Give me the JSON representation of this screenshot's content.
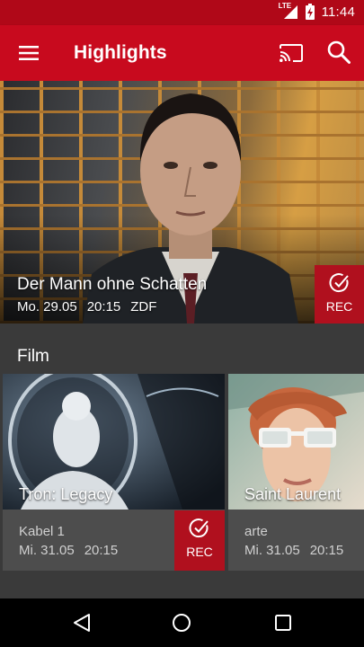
{
  "status_bar": {
    "network": "LTE",
    "time": "11:44"
  },
  "app_bar": {
    "title": "Highlights",
    "icons": [
      "menu-icon",
      "cast-icon",
      "search-icon"
    ]
  },
  "hero": {
    "title": "Der Mann ohne Schatten",
    "date": "Mo. 29.05",
    "time": "20:15",
    "channel": "ZDF",
    "rec_label": "REC",
    "rec_icon": "check-circle-icon"
  },
  "section": {
    "title": "Film"
  },
  "cards": [
    {
      "title": "Tron: Legacy",
      "channel": "Kabel 1",
      "date": "Mi. 31.05",
      "time": "20:15",
      "rec_label": "REC"
    },
    {
      "title": "Saint Laurent",
      "channel": "arte",
      "date": "Mi. 31.05",
      "time": "20:15"
    }
  ],
  "nav_bar": {
    "icons": [
      "back-icon",
      "home-icon",
      "recents-icon"
    ]
  },
  "colors": {
    "primary": "#c80a1e",
    "status_bar": "#b00818",
    "rec_button": "#b0101e",
    "background": "#3a3a3a",
    "card": "#4d4d4d"
  }
}
